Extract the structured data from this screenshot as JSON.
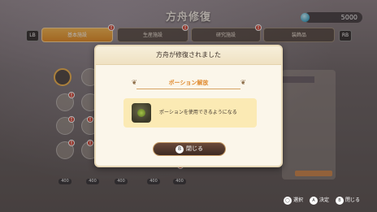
{
  "header": {
    "title": "方舟修復",
    "currency_value": "5000",
    "left_shoulder": "LB",
    "right_shoulder": "RB"
  },
  "tabs": [
    {
      "label": "基本施設",
      "active": true
    },
    {
      "label": "生産施設",
      "active": false
    },
    {
      "label": "研究施設",
      "active": false
    },
    {
      "label": "装飾品",
      "active": false
    }
  ],
  "grid": {
    "item_badges": [
      "400",
      "400",
      "400",
      "400",
      "400"
    ]
  },
  "dialog": {
    "title": "方舟が修復されました",
    "ribbon": "ポーション解放",
    "message": "ポーションを使用できるようになる",
    "close_key": "B",
    "close_label": "閉じる"
  },
  "footer": {
    "select_key": "◯",
    "select_label": "選択",
    "confirm_key": "A",
    "confirm_label": "決定",
    "close_key": "B",
    "close_label": "閉じる"
  },
  "colors": {
    "accent": "#f4a640",
    "alert": "#d13a28",
    "dialog_bg": "#fbf6ea",
    "content_bg": "#fbeab4"
  }
}
